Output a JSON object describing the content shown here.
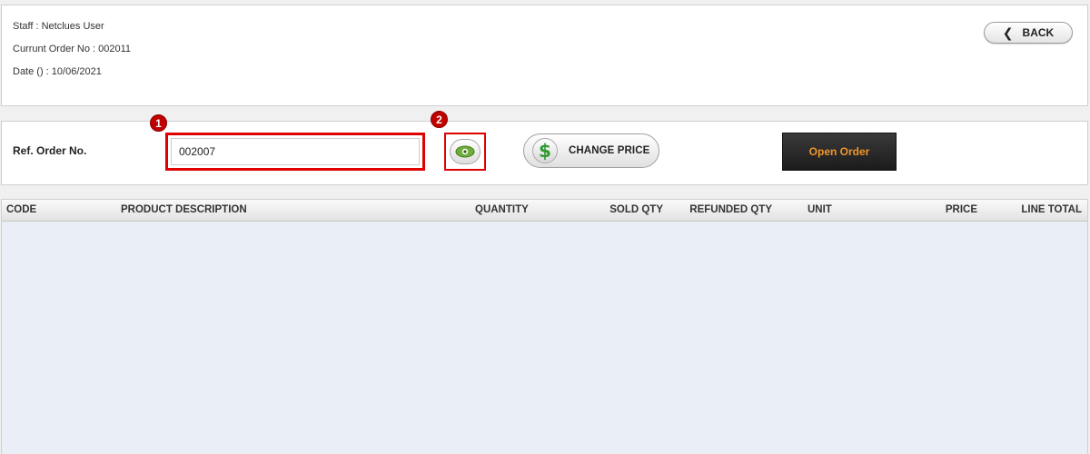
{
  "header": {
    "staff_label": "Staff : ",
    "staff_value": "Netclues User",
    "order_label": "Currunt Order No : ",
    "order_value": "002011",
    "date_label": "Date () : ",
    "date_value": "10/06/2021",
    "back_label": "BACK"
  },
  "ref_order": {
    "label": "Ref. Order No.",
    "value": "002007",
    "badge_1": "1",
    "badge_2": "2"
  },
  "actions": {
    "change_price_label": "CHANGE PRICE",
    "dollar_symbol": "$",
    "open_order_label": "Open Order"
  },
  "table": {
    "columns": [
      "CODE",
      "PRODUCT DESCRIPTION",
      "QUANTITY",
      "SOLD QTY",
      "REFUNDED QTY",
      "UNIT",
      "PRICE",
      "LINE TOTAL"
    ],
    "rows": []
  },
  "colors": {
    "highlight_red": "#e00000",
    "open_order_text": "#f0962c",
    "dollar_green": "#2e9a2e",
    "grid_background": "#eaeef6"
  },
  "icons": {
    "back": "chevron-left-icon",
    "view": "eye-icon",
    "price": "dollar-icon"
  }
}
